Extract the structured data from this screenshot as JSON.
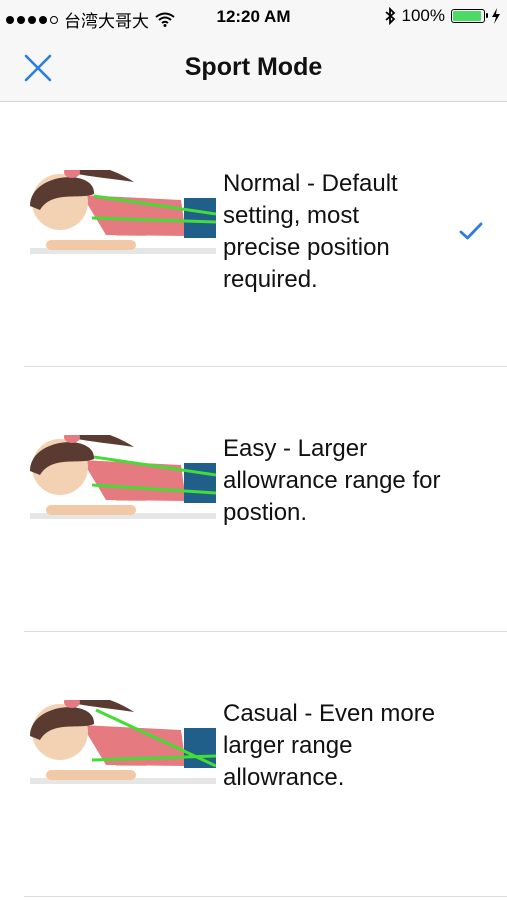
{
  "status_bar": {
    "carrier": "台湾大哥大",
    "time": "12:20 AM",
    "battery": "100%",
    "icons": [
      "signal-dots-icon",
      "wifi-icon",
      "bluetooth-icon",
      "battery-icon",
      "charging-bolt-icon"
    ]
  },
  "nav": {
    "title": "Sport Mode",
    "close_icon": "close-icon",
    "accent": "#2a7de1"
  },
  "modes": [
    {
      "text": "Normal - Default setting, most precise position required.",
      "selected": true
    },
    {
      "text": "Easy - Larger allowrance range for postion.",
      "selected": false
    },
    {
      "text": "Casual - Even more larger range allowrance.",
      "selected": false
    }
  ]
}
